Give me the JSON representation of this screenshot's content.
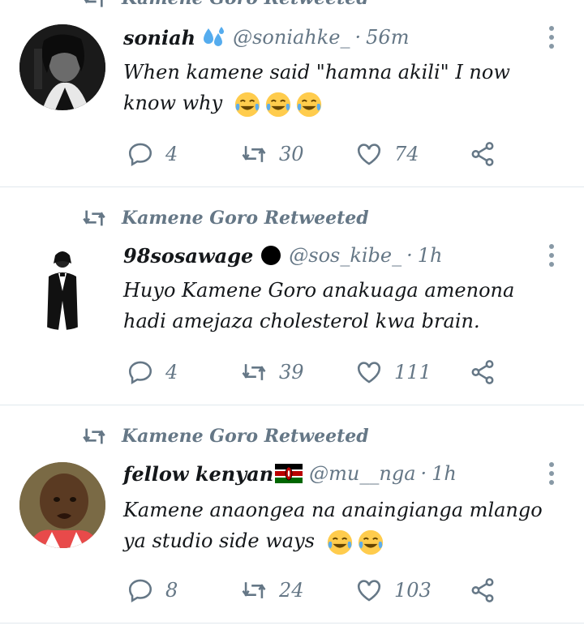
{
  "top_retweet_label": "Kamene Goro Retweeted",
  "tweets": [
    {
      "display_name": "soniah",
      "name_emoji": "sweat-droplets-icon",
      "handle": "@soniahke_",
      "dot": "·",
      "time": "56m",
      "text": "When kamene said \"hamna akili\" I now know why",
      "text_emoji_count": 3,
      "reply_count": "4",
      "retweet_count": "30",
      "like_count": "74"
    },
    {
      "retweet_label": "Kamene Goro Retweeted",
      "display_name": "98sosawage",
      "name_emoji": "black-circle-icon",
      "handle": "@sos_kibe_",
      "dot": "·",
      "time": "1h",
      "text": "Huyo Kamene Goro anakuaga amenona hadi amejaza cholesterol kwa brain.",
      "text_emoji_count": 0,
      "reply_count": "4",
      "retweet_count": "39",
      "like_count": "111"
    },
    {
      "retweet_label": "Kamene Goro Retweeted",
      "display_name": "fellow kenyan",
      "name_emoji": "kenya-flag-icon",
      "handle": "@mu__nga",
      "dot": "·",
      "time": "1h",
      "text": "Kamene anaongea na anaingianga mlango ya studio side ways",
      "text_emoji_count": 2,
      "reply_count": "8",
      "retweet_count": "24",
      "like_count": "103"
    }
  ],
  "colors": {
    "text": "#14171a",
    "secondary": "#657786",
    "divider": "#e1e8ed",
    "more_dots": "#8899a6"
  }
}
